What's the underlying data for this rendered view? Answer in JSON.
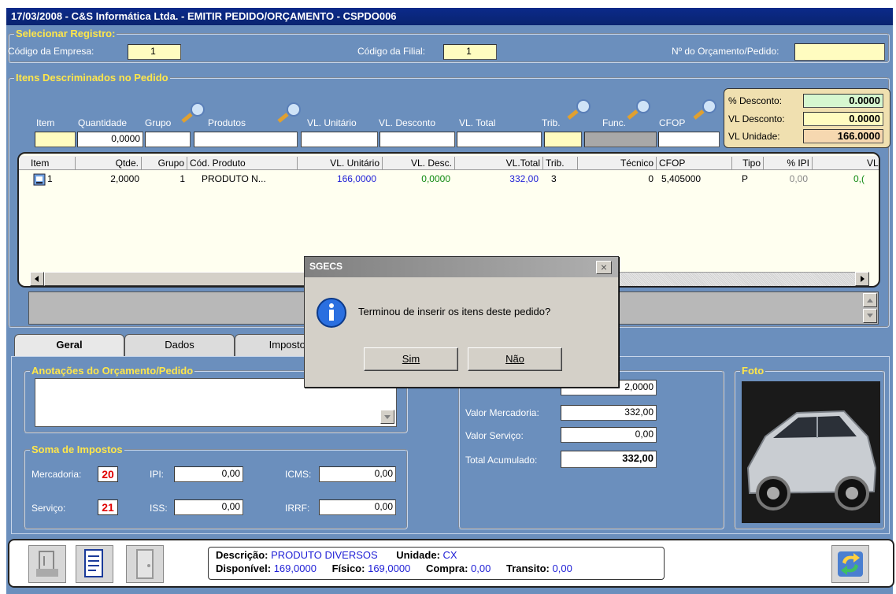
{
  "title": "17/03/2008  -  C&S Informática Ltda.  -  EMITIR PEDIDO/ORÇAMENTO  -  CSPDO006",
  "selecionar": {
    "title": "Selecionar Registro:",
    "codigo_empresa_label": "Código da Empresa:",
    "codigo_empresa_value": "1",
    "codigo_filial_label": "Código da Filial:",
    "codigo_filial_value": "1",
    "numero_label": "Nº do Orçamento/Pedido:",
    "numero_value": ""
  },
  "itens": {
    "title": "Itens Descriminados no Pedido",
    "fields": {
      "item": "Item",
      "quantidade": "Quantidade",
      "grupo": "Grupo",
      "produtos": "Produtos",
      "vl_unitario": "VL. Unitário",
      "vl_desconto": "VL. Desconto",
      "vl_total": "VL. Total",
      "trib": "Trib.",
      "func": "Func.",
      "cfop": "CFOP",
      "quantidade_value": "0,0000"
    },
    "desconto": {
      "pct_label": "% Desconto:",
      "pct_value": "0.0000",
      "vl_label": "VL Desconto:",
      "vl_value": "0.0000",
      "unidade_label": "VL Unidade:",
      "unidade_value": "166.0000"
    },
    "columns": [
      "Item",
      "Qtde.",
      "Grupo",
      "Cód. Produto",
      "VL. Unitário",
      "VL. Desc.",
      "VL.Total",
      "Trib.",
      "Técnico",
      "CFOP",
      "Tipo",
      "% IPI",
      "VL. II"
    ],
    "row": {
      "item": "1",
      "qtde": "2,0000",
      "grupo": "1",
      "produto": "PRODUTO N...",
      "unitario": "166,0000",
      "desc": "0,0000",
      "total": "332,00",
      "trib": "3",
      "tecnico": "0",
      "cfop": "5,405000",
      "tipo": "P",
      "ipi": "0,00",
      "vlii": "0,("
    }
  },
  "tabs": [
    "Geral",
    "Dados",
    "Impostos"
  ],
  "anotacoes": {
    "title": "Anotações do Orçamento/Pedido"
  },
  "soma": {
    "title": "Soma de Impostos",
    "mercadoria_label": "Mercadoria:",
    "mercadoria_code": "20",
    "servico_label": "Serviço:",
    "servico_code": "21",
    "ipi_label": "IPI:",
    "ipi_value": "0,00",
    "icms_label": "ICMS:",
    "icms_value": "0,00",
    "iss_label": "ISS:",
    "iss_value": "0,00",
    "irrf_label": "IRRF:",
    "irrf_value": "0,00"
  },
  "totais": {
    "quantidade_value": "2,0000",
    "mercadoria_label": "Valor Mercadoria:",
    "mercadoria_value": "332,00",
    "servico_label": "Valor Serviço:",
    "servico_value": "0,00",
    "acumulado_label": "Total Acumulado:",
    "acumulado_value": "332,00"
  },
  "foto": {
    "title": "Foto"
  },
  "status": {
    "descricao_label": "Descrição:",
    "descricao_value": "PRODUTO DIVERSOS",
    "unidade_label": "Unidade:",
    "unidade_value": "CX",
    "disponivel_label": "Disponível:",
    "disponivel_value": "169,0000",
    "fisico_label": "Físico:",
    "fisico_value": "169,0000",
    "compra_label": "Compra:",
    "compra_value": "0,00",
    "transito_label": "Transito:",
    "transito_value": "0,00"
  },
  "dialog": {
    "title": "SGECS",
    "message": "Terminou de inserir os itens deste pedido?",
    "yes": "Sim",
    "no": "Não",
    "close": "×"
  },
  "colors": {
    "window_bg": "#6b8fbd",
    "group_title": "#ffe64a",
    "blue_value": "#1f1fd6",
    "green_value": "#108a10",
    "red_badge": "#e00000"
  },
  "icons": [
    "magnifier-pencil-icon",
    "info-icon",
    "car-photo",
    "calculator-icon",
    "document-icon",
    "door-icon",
    "sync-icon"
  ]
}
